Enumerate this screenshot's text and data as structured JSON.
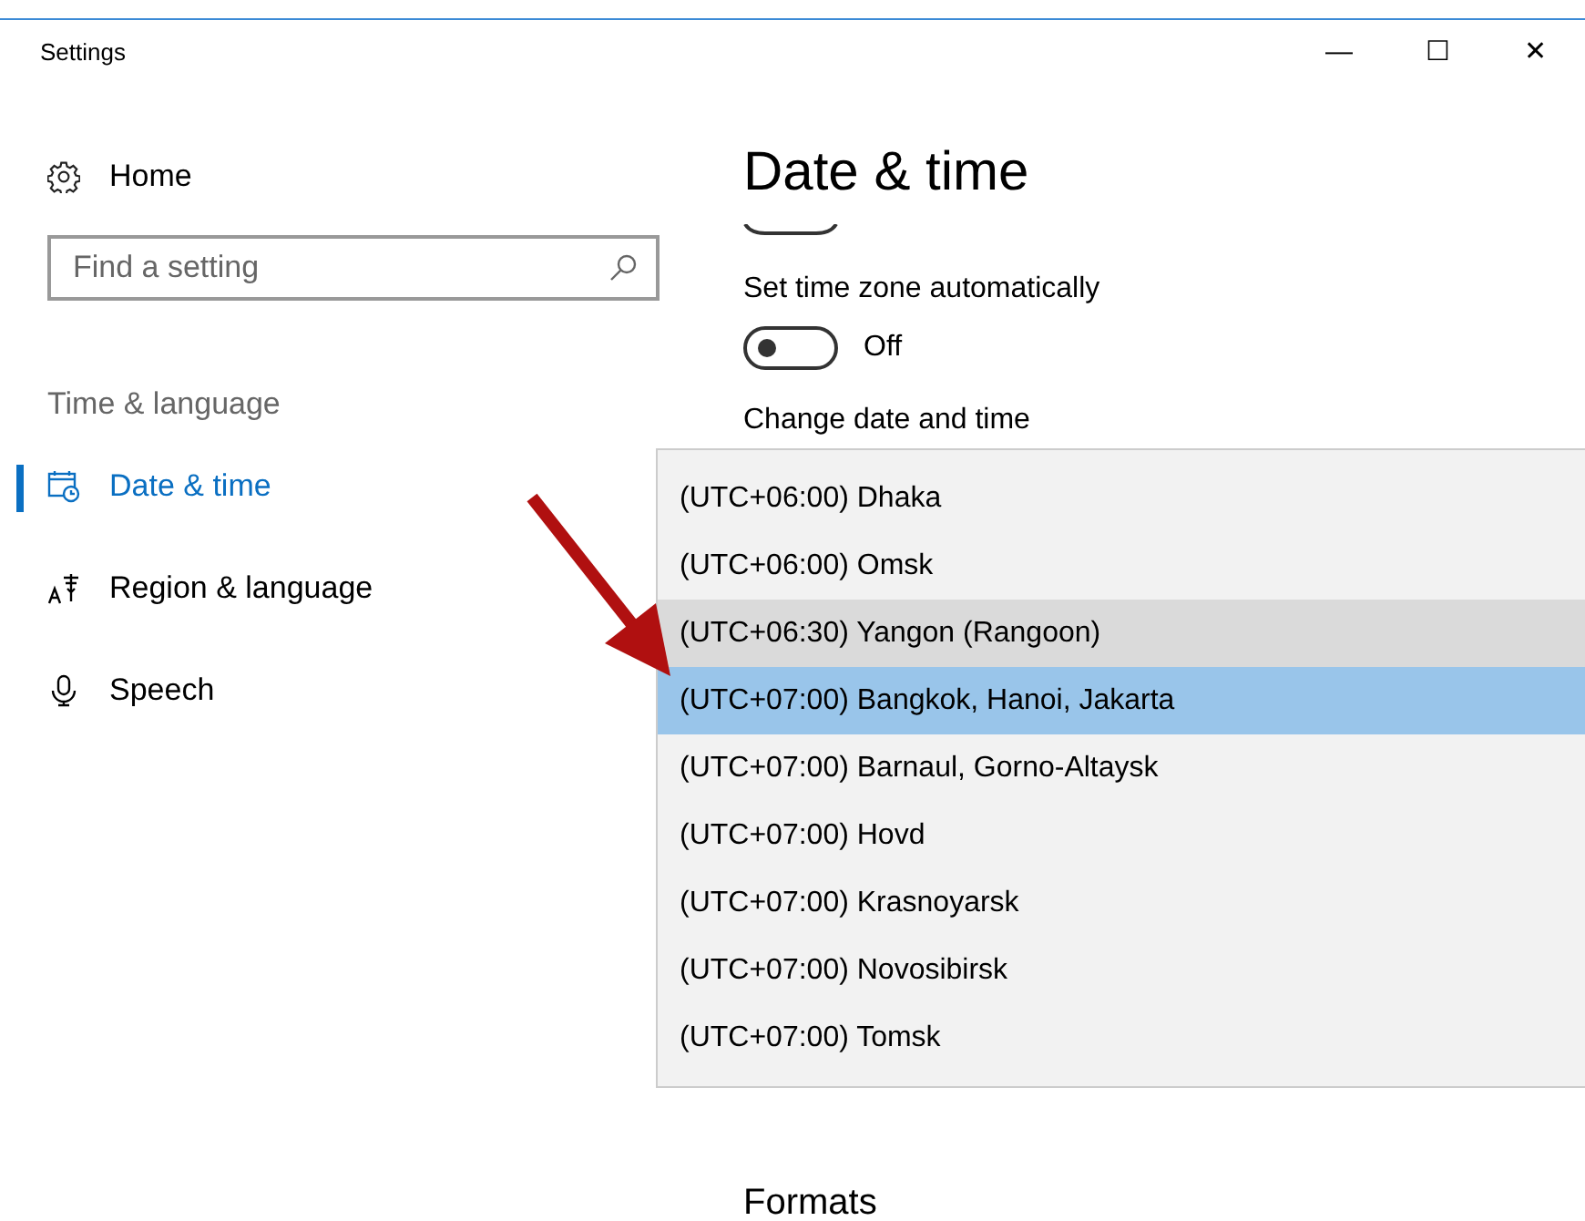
{
  "window": {
    "title": "Settings",
    "controls": [
      "—",
      "☐",
      "✕"
    ]
  },
  "sidebar": {
    "home": "Home",
    "search": {
      "placeholder": "Find a setting"
    },
    "section": "Time & language",
    "items": [
      {
        "label": "Date & time",
        "kind": "calendar",
        "selected": true
      },
      {
        "label": "Region & language",
        "kind": "language",
        "selected": false
      },
      {
        "label": "Speech",
        "kind": "microphone",
        "selected": false
      }
    ]
  },
  "content": {
    "title": "Date & time",
    "auto_timezone": {
      "label": "Set time zone automatically",
      "on": false,
      "state_text": "Off"
    },
    "change_heading": "Change date and time",
    "formats_heading": "Formats"
  },
  "timezone_dropdown": {
    "options": [
      {
        "label": "(UTC+06:00) Dhaka",
        "selected": false,
        "hovered": false
      },
      {
        "label": "(UTC+06:00) Omsk",
        "selected": false,
        "hovered": false
      },
      {
        "label": "(UTC+06:30) Yangon (Rangoon)",
        "selected": false,
        "hovered": true
      },
      {
        "label": "(UTC+07:00) Bangkok, Hanoi, Jakarta",
        "selected": true,
        "hovered": false
      },
      {
        "label": "(UTC+07:00) Barnaul, Gorno-Altaysk",
        "selected": false,
        "hovered": false
      },
      {
        "label": "(UTC+07:00) Hovd",
        "selected": false,
        "hovered": false
      },
      {
        "label": "(UTC+07:00) Krasnoyarsk",
        "selected": false,
        "hovered": false
      },
      {
        "label": "(UTC+07:00) Novosibirsk",
        "selected": false,
        "hovered": false
      },
      {
        "label": "(UTC+07:00) Tomsk",
        "selected": false,
        "hovered": false
      }
    ]
  }
}
